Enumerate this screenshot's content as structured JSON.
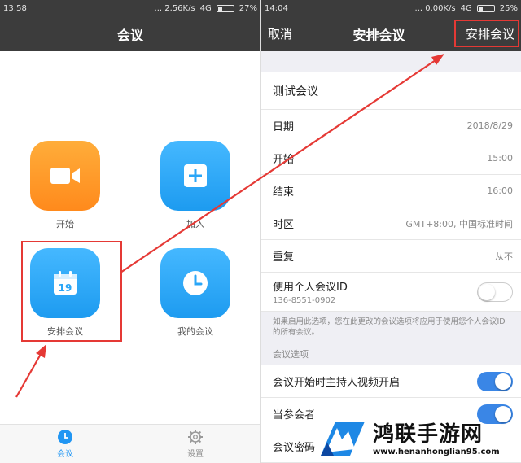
{
  "left": {
    "status": {
      "time": "13:58",
      "network": "... 2.56K/s",
      "signal": "4G",
      "battery": "27%"
    },
    "title": "会议",
    "tiles": [
      {
        "label": "开始",
        "icon": "video-camera-icon",
        "color": "#ff9a2a"
      },
      {
        "label": "加入",
        "icon": "plus-icon",
        "color": "#2aa6f7"
      },
      {
        "label": "安排会议",
        "icon": "calendar-icon",
        "date": "19",
        "color": "#2aa6f7"
      },
      {
        "label": "我的会议",
        "icon": "clock-icon",
        "color": "#2aa6f7"
      }
    ],
    "tabs": [
      {
        "label": "会议",
        "icon": "clock-icon",
        "active": true
      },
      {
        "label": "设置",
        "icon": "gear-icon",
        "active": false
      }
    ]
  },
  "right": {
    "status": {
      "time": "14:04",
      "network": "... 0.00K/s",
      "signal": "4G",
      "battery": "25%"
    },
    "cancel": "取消",
    "title": "安排会议",
    "schedule": "安排会议",
    "topic": "测试会议",
    "rows": [
      {
        "key": "日期",
        "value": "2018/8/29"
      },
      {
        "key": "开始",
        "value": "15:00"
      },
      {
        "key": "结束",
        "value": "16:00"
      },
      {
        "key": "时区",
        "value": "GMT+8:00, 中国标准时间"
      },
      {
        "key": "重复",
        "value": "从不"
      }
    ],
    "personal_id": {
      "label": "使用个人会议ID",
      "id": "136-8551-0902",
      "on": false
    },
    "note": "如果启用此选项，您在此更改的会议选项将应用于使用您个人会议ID的所有会议。",
    "options_title": "会议选项",
    "options": [
      {
        "label": "会议开始时主持人视频开启",
        "on": true
      },
      {
        "label": "当参会者",
        "on": true
      },
      {
        "label": "会议密码",
        "on": false
      }
    ]
  },
  "watermark": {
    "title": "鸿联手游网",
    "url": "www.henanhonglian95.com"
  },
  "colors": {
    "accent": "#e53935",
    "nav": "#3c3c3c",
    "toggle_on": "#3a86e6"
  }
}
